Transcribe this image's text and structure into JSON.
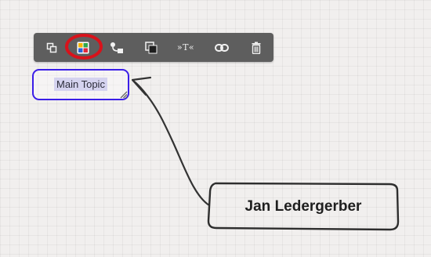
{
  "toolbar": {
    "buttons": [
      {
        "icon": "add-subtopic-icon"
      },
      {
        "icon": "color-palette-icon",
        "highlighted": true
      },
      {
        "icon": "connector-icon"
      },
      {
        "icon": "shape-style-icon"
      },
      {
        "icon": "text-format-icon",
        "label": "»T«"
      },
      {
        "icon": "link-icon"
      },
      {
        "icon": "trash-icon"
      }
    ]
  },
  "topic": {
    "label": "Main Topic"
  },
  "callout": {
    "label": "Jan Ledergerber"
  },
  "colors": {
    "toolbar_bg": "#5e5e5e",
    "selection_border": "#3b1ee8",
    "highlight_ring": "#d8121b",
    "sketch_stroke": "#333333"
  }
}
